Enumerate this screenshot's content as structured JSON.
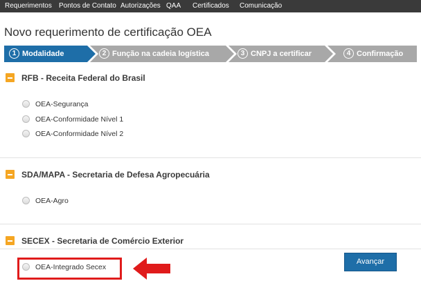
{
  "nav": {
    "items": [
      "Requerimentos",
      "Pontos de Contato",
      "Autorizações",
      "QAA",
      "Certificados",
      "Comunicação"
    ]
  },
  "page": {
    "title": "Novo requerimento de certificação OEA"
  },
  "stepper": {
    "active_color": "#1e6ea8",
    "inactive_color": "#a8a8a8",
    "active_step": 1,
    "steps": [
      {
        "num": "1",
        "label": "Modalidade"
      },
      {
        "num": "2",
        "label": "Função na cadeia logística"
      },
      {
        "num": "3",
        "label": "CNPJ a certificar"
      },
      {
        "num": "4",
        "label": "Confirmação"
      }
    ]
  },
  "sections": [
    {
      "title": "RFB - Receita Federal do Brasil",
      "options": [
        "OEA-Segurança",
        "OEA-Conformidade Nível 1",
        "OEA-Conformidade Nível 2"
      ]
    },
    {
      "title": "SDA/MAPA - Secretaria de Defesa Agropecuária",
      "options": [
        "OEA-Agro"
      ]
    },
    {
      "title": "SECEX - Secretaria de Comércio Exterior",
      "options": [
        "OEA-Integrado Secex"
      ]
    }
  ],
  "annotation": {
    "color": "#e01b1b",
    "icon": "red-arrow-left-icon"
  },
  "actions": {
    "advance_label": "Avançar"
  }
}
